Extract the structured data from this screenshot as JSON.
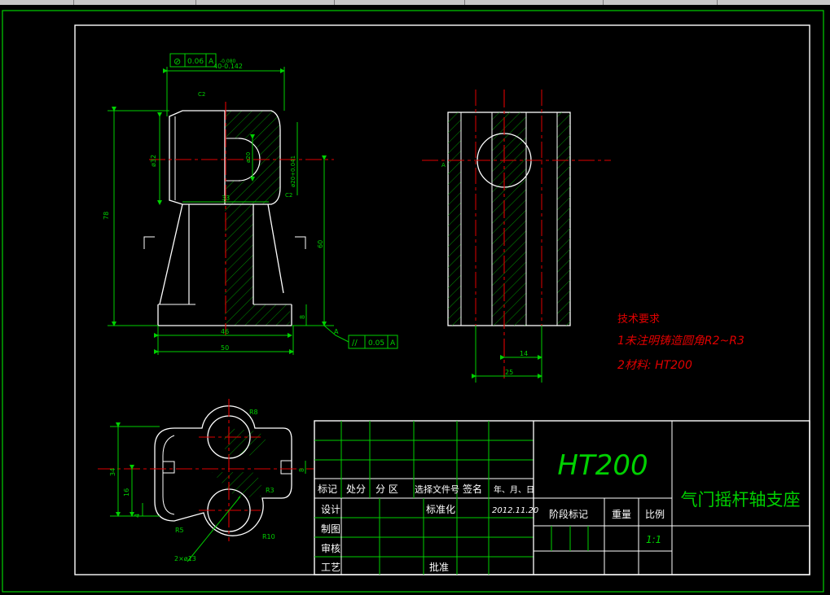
{
  "tolerances": {
    "top_frame": {
      "symbol": "⊘",
      "value": "0.06",
      "datum": "A"
    },
    "bottom_frame": {
      "symbol": "//",
      "value": "0.05",
      "datum": "A"
    }
  },
  "dims": {
    "d40": "40-0.142",
    "d40_tol": "-0.080",
    "d32": "ø32",
    "d20": "ø20",
    "d20h": "ø20+0.041",
    "c2": "C2",
    "d33": "33",
    "d78": "78",
    "d60": "60",
    "d8": "8",
    "d46": "46",
    "d50": "50",
    "d14": "14",
    "d25": "25",
    "r8": "R8",
    "r3": "R3",
    "r5": "R5",
    "r10": "R10",
    "d13": "2×ø13",
    "d34": "34",
    "d16": "16",
    "d4": "4",
    "d8b": "8",
    "datum_a": "A"
  },
  "notes": {
    "title": "技术要求",
    "line1": "1未注明铸造圆角R2~R3",
    "line2": "2材料: HT200"
  },
  "title_block": {
    "material": "HT200",
    "part_name": "气门摇杆轴支座",
    "h_mark": "标记",
    "h_count": "处分",
    "h_zone": "分  区",
    "h_doc": "选择文件号",
    "h_sign": "签名",
    "h_date": "年、月、日",
    "design": "设计",
    "standard": "标准化",
    "date_value": "2012.11.20",
    "draw": "制图",
    "check": "审核",
    "process": "工艺",
    "approve": "批准",
    "stage": "阶段标记",
    "weight": "重量",
    "ratio": "比例",
    "ratio_value": "1:1"
  }
}
